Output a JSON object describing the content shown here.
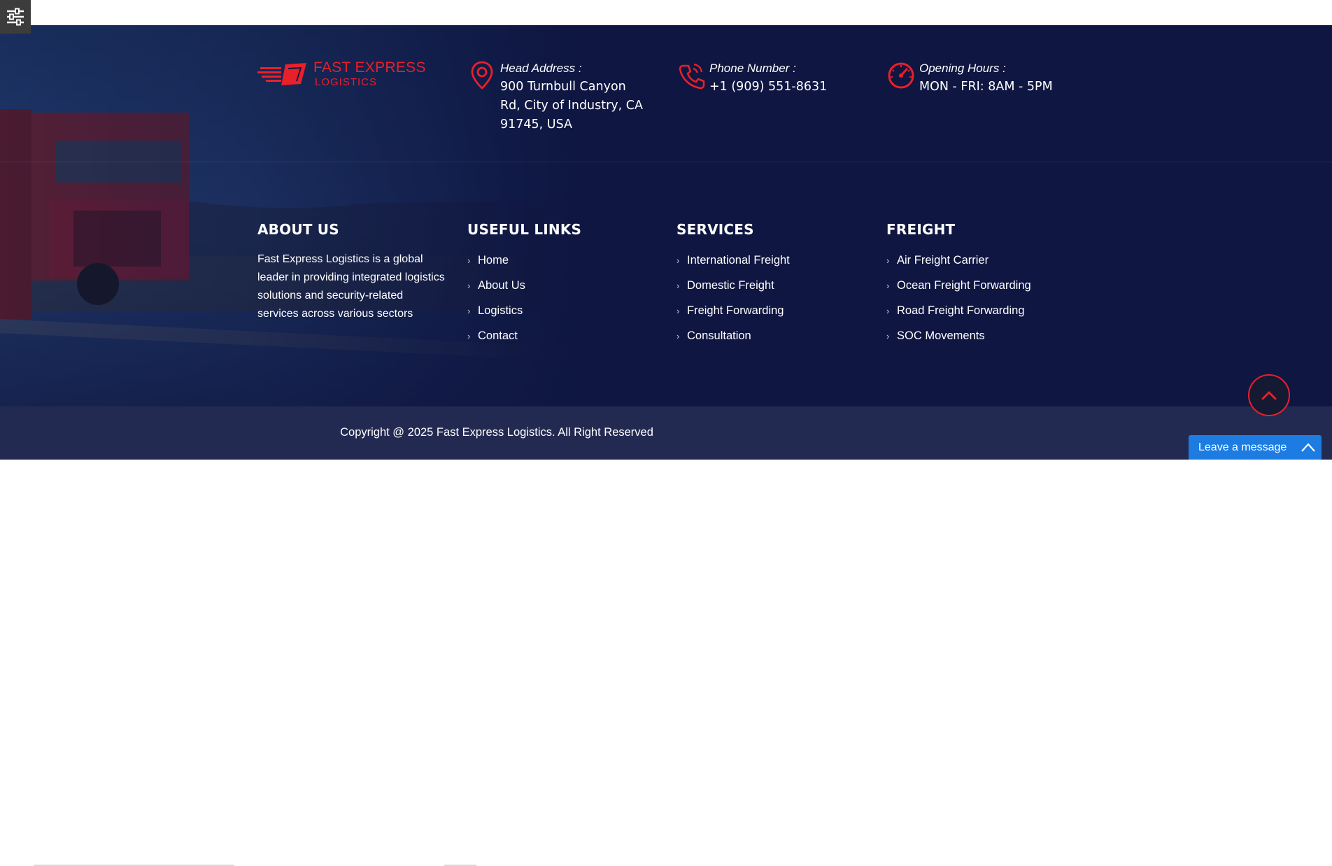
{
  "brand": {
    "line1": "FAST EXPRESS",
    "line2": "LOGISTICS"
  },
  "contact": [
    {
      "label": "Head Address :",
      "value_lines": [
        "900 Turnbull Canyon",
        "Rd, City of Industry, CA",
        "91745, USA"
      ],
      "icon": "map-pin-icon"
    },
    {
      "label": "Phone Number :",
      "value_lines": [
        "+1 (909) 551-8631"
      ],
      "icon": "phone-icon"
    },
    {
      "label": "Opening Hours :",
      "value_lines": [
        "MON - FRI: 8AM - 5PM"
      ],
      "icon": "speedometer-icon"
    }
  ],
  "about": {
    "title": "ABOUT US",
    "text_lines": [
      "Fast Express Logistics is a global",
      "leader in providing integrated logistics",
      "solutions and security-related",
      "services across various sectors"
    ]
  },
  "useful_links": {
    "title": "USEFUL LINKS",
    "items": [
      "Home",
      "About Us",
      "Logistics",
      "Contact"
    ]
  },
  "services": {
    "title": "SERVICES",
    "items": [
      "International Freight",
      "Domestic Freight",
      "Freight Forwarding",
      "Consultation"
    ]
  },
  "freight": {
    "title": "FREIGHT",
    "items": [
      "Air Freight Carrier",
      "Ocean Freight Forwarding",
      "Road Freight Forwarding",
      "SOC Movements"
    ]
  },
  "copyright": "Copyright @ 2025 Fast Express Logistics. All Right Reserved",
  "chat": {
    "label": "Leave a message"
  },
  "colors": {
    "footer_bg": "#0f1641",
    "accent": "#e8202a",
    "bottom_bar": "#232a52",
    "chat": "#1c7ce2"
  }
}
